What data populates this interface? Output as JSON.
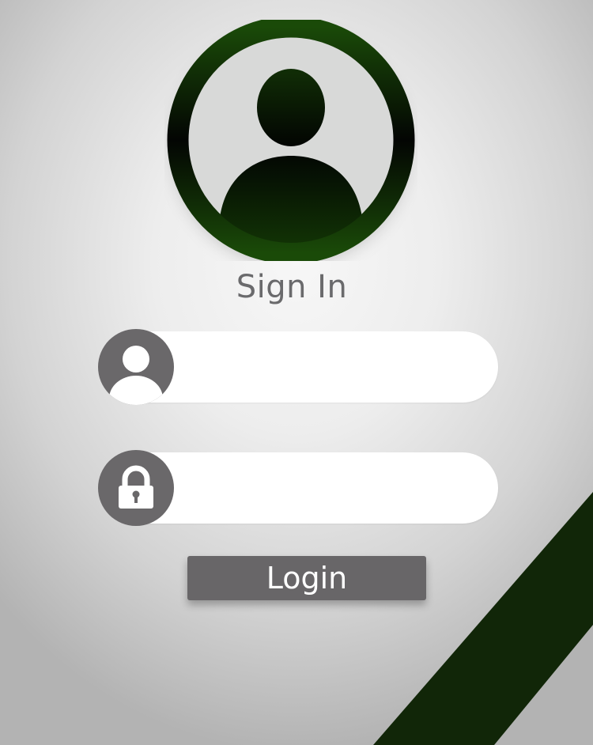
{
  "page": {
    "title": "Sign In"
  },
  "header": {
    "avatar_icon": "user-avatar-icon"
  },
  "form": {
    "username": {
      "icon": "user-icon",
      "value": "",
      "placeholder": ""
    },
    "password": {
      "icon": "lock-icon",
      "value": "",
      "placeholder": ""
    },
    "login_label": "Login"
  },
  "colors": {
    "brand_green": "#1a4a08",
    "dark_stripe": "#112608",
    "icon_gray": "#6a686a",
    "text_gray": "#6a6a6c",
    "button_gray": "#686668"
  }
}
